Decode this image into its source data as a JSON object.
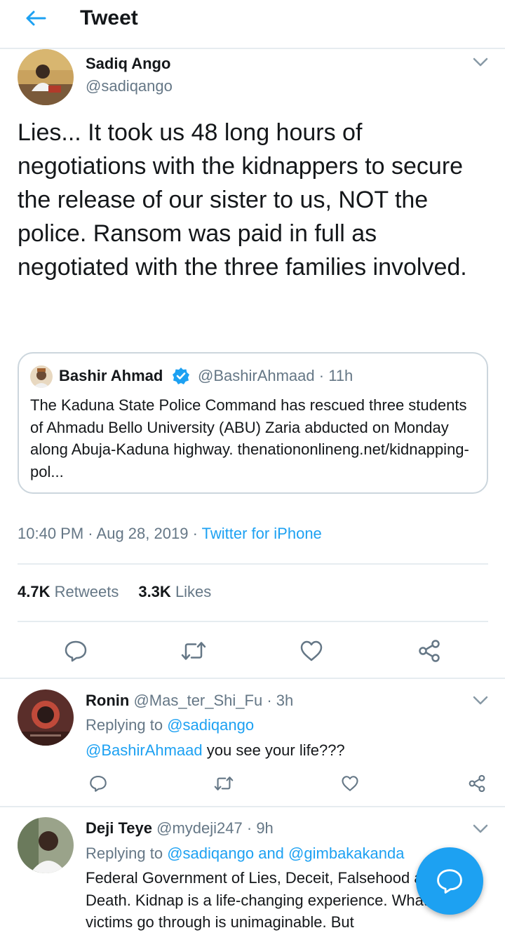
{
  "header": {
    "title": "Tweet"
  },
  "tweet": {
    "author_name": "Sadiq Ango",
    "author_handle": "@sadiqango",
    "text": "Lies... It took us 48 long hours of negotiations with the kidnappers to secure the release of our sister to us, NOT the police. Ransom was paid in full as negotiated with the three families involved.",
    "quote": {
      "author_name": "Bashir Ahmad",
      "author_handle": "@BashirAhmaad",
      "separator": "·",
      "time": "11h",
      "text": "The Kaduna State Police Command has rescued three students of Ahmadu Bello  University (ABU) Zaria abducted on Monday along Abuja-Kaduna highway. thenationonlineng.net/kidnapping-pol..."
    },
    "time": "10:40 PM",
    "date": "Aug 28, 2019",
    "separator": "·",
    "source": "Twitter for iPhone",
    "retweets_count": "4.7K",
    "retweets_label": "Retweets",
    "likes_count": "3.3K",
    "likes_label": "Likes"
  },
  "replies": [
    {
      "name": "Ronin",
      "handle": "@Mas_ter_Shi_Fu",
      "separator": "·",
      "time": "3h",
      "replying_prefix": "Replying to",
      "replying_handle": "@sadiqango",
      "mention": "@BashirAhmaad",
      "text": "you see your life???"
    },
    {
      "name": "Deji Teye",
      "handle": "@mydeji247",
      "separator": "·",
      "time": "9h",
      "replying_prefix": "Replying to",
      "replying_handle": "@sadiqango",
      "replying_and": "and",
      "replying_handle2": "@gimbakakanda",
      "text": "Federal Government of Lies, Deceit, Falsehood and Death. Kidnap is a life-changing experience. What the victims go through is unimaginable. But"
    }
  ],
  "colors": {
    "accent": "#1da1f2",
    "secondary_text": "#657786",
    "divider": "#e6ecf0"
  },
  "icons": [
    "back-arrow-icon",
    "chevron-down-icon",
    "verified-badge-icon",
    "reply-icon",
    "retweet-icon",
    "like-icon",
    "share-icon",
    "compose-reply-icon"
  ]
}
